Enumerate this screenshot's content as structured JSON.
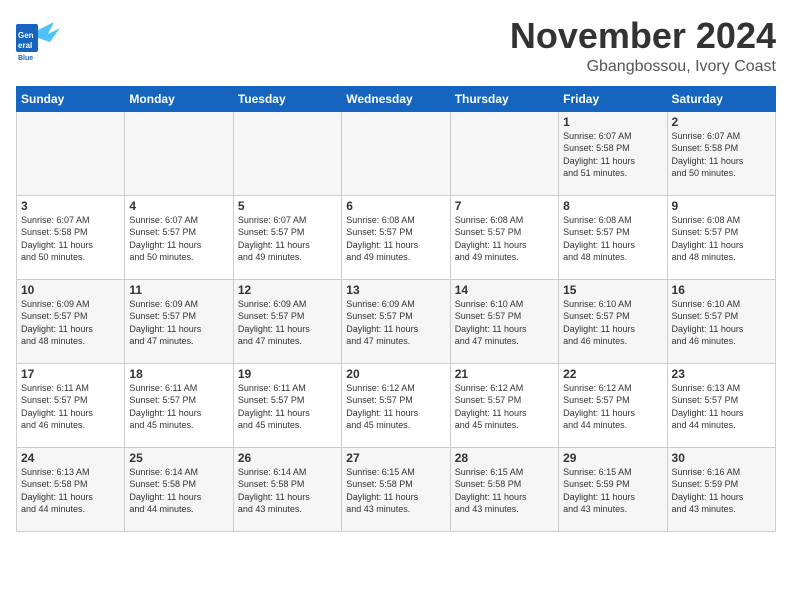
{
  "header": {
    "logo_general": "General",
    "logo_blue": "Blue",
    "month": "November 2024",
    "location": "Gbangbossou, Ivory Coast"
  },
  "weekdays": [
    "Sunday",
    "Monday",
    "Tuesday",
    "Wednesday",
    "Thursday",
    "Friday",
    "Saturday"
  ],
  "weeks": [
    [
      {
        "day": "",
        "info": ""
      },
      {
        "day": "",
        "info": ""
      },
      {
        "day": "",
        "info": ""
      },
      {
        "day": "",
        "info": ""
      },
      {
        "day": "",
        "info": ""
      },
      {
        "day": "1",
        "info": "Sunrise: 6:07 AM\nSunset: 5:58 PM\nDaylight: 11 hours\nand 51 minutes."
      },
      {
        "day": "2",
        "info": "Sunrise: 6:07 AM\nSunset: 5:58 PM\nDaylight: 11 hours\nand 50 minutes."
      }
    ],
    [
      {
        "day": "3",
        "info": "Sunrise: 6:07 AM\nSunset: 5:58 PM\nDaylight: 11 hours\nand 50 minutes."
      },
      {
        "day": "4",
        "info": "Sunrise: 6:07 AM\nSunset: 5:57 PM\nDaylight: 11 hours\nand 50 minutes."
      },
      {
        "day": "5",
        "info": "Sunrise: 6:07 AM\nSunset: 5:57 PM\nDaylight: 11 hours\nand 49 minutes."
      },
      {
        "day": "6",
        "info": "Sunrise: 6:08 AM\nSunset: 5:57 PM\nDaylight: 11 hours\nand 49 minutes."
      },
      {
        "day": "7",
        "info": "Sunrise: 6:08 AM\nSunset: 5:57 PM\nDaylight: 11 hours\nand 49 minutes."
      },
      {
        "day": "8",
        "info": "Sunrise: 6:08 AM\nSunset: 5:57 PM\nDaylight: 11 hours\nand 48 minutes."
      },
      {
        "day": "9",
        "info": "Sunrise: 6:08 AM\nSunset: 5:57 PM\nDaylight: 11 hours\nand 48 minutes."
      }
    ],
    [
      {
        "day": "10",
        "info": "Sunrise: 6:09 AM\nSunset: 5:57 PM\nDaylight: 11 hours\nand 48 minutes."
      },
      {
        "day": "11",
        "info": "Sunrise: 6:09 AM\nSunset: 5:57 PM\nDaylight: 11 hours\nand 47 minutes."
      },
      {
        "day": "12",
        "info": "Sunrise: 6:09 AM\nSunset: 5:57 PM\nDaylight: 11 hours\nand 47 minutes."
      },
      {
        "day": "13",
        "info": "Sunrise: 6:09 AM\nSunset: 5:57 PM\nDaylight: 11 hours\nand 47 minutes."
      },
      {
        "day": "14",
        "info": "Sunrise: 6:10 AM\nSunset: 5:57 PM\nDaylight: 11 hours\nand 47 minutes."
      },
      {
        "day": "15",
        "info": "Sunrise: 6:10 AM\nSunset: 5:57 PM\nDaylight: 11 hours\nand 46 minutes."
      },
      {
        "day": "16",
        "info": "Sunrise: 6:10 AM\nSunset: 5:57 PM\nDaylight: 11 hours\nand 46 minutes."
      }
    ],
    [
      {
        "day": "17",
        "info": "Sunrise: 6:11 AM\nSunset: 5:57 PM\nDaylight: 11 hours\nand 46 minutes."
      },
      {
        "day": "18",
        "info": "Sunrise: 6:11 AM\nSunset: 5:57 PM\nDaylight: 11 hours\nand 45 minutes."
      },
      {
        "day": "19",
        "info": "Sunrise: 6:11 AM\nSunset: 5:57 PM\nDaylight: 11 hours\nand 45 minutes."
      },
      {
        "day": "20",
        "info": "Sunrise: 6:12 AM\nSunset: 5:57 PM\nDaylight: 11 hours\nand 45 minutes."
      },
      {
        "day": "21",
        "info": "Sunrise: 6:12 AM\nSunset: 5:57 PM\nDaylight: 11 hours\nand 45 minutes."
      },
      {
        "day": "22",
        "info": "Sunrise: 6:12 AM\nSunset: 5:57 PM\nDaylight: 11 hours\nand 44 minutes."
      },
      {
        "day": "23",
        "info": "Sunrise: 6:13 AM\nSunset: 5:57 PM\nDaylight: 11 hours\nand 44 minutes."
      }
    ],
    [
      {
        "day": "24",
        "info": "Sunrise: 6:13 AM\nSunset: 5:58 PM\nDaylight: 11 hours\nand 44 minutes."
      },
      {
        "day": "25",
        "info": "Sunrise: 6:14 AM\nSunset: 5:58 PM\nDaylight: 11 hours\nand 44 minutes."
      },
      {
        "day": "26",
        "info": "Sunrise: 6:14 AM\nSunset: 5:58 PM\nDaylight: 11 hours\nand 43 minutes."
      },
      {
        "day": "27",
        "info": "Sunrise: 6:15 AM\nSunset: 5:58 PM\nDaylight: 11 hours\nand 43 minutes."
      },
      {
        "day": "28",
        "info": "Sunrise: 6:15 AM\nSunset: 5:58 PM\nDaylight: 11 hours\nand 43 minutes."
      },
      {
        "day": "29",
        "info": "Sunrise: 6:15 AM\nSunset: 5:59 PM\nDaylight: 11 hours\nand 43 minutes."
      },
      {
        "day": "30",
        "info": "Sunrise: 6:16 AM\nSunset: 5:59 PM\nDaylight: 11 hours\nand 43 minutes."
      }
    ]
  ]
}
